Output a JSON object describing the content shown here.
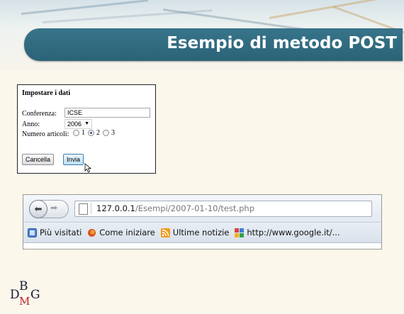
{
  "slide": {
    "title": "Esempio di metodo POST",
    "logo": "DBMG"
  },
  "form": {
    "heading": "Impostare i dati",
    "conference_label": "Conferenza:",
    "conference_value": "ICSE",
    "year_label": "Anno:",
    "year_value": "2006",
    "articles_label": "Numero articoli:",
    "articles_options": [
      "1",
      "2",
      "3"
    ],
    "articles_selected": "2",
    "cancel_label": "Cancella",
    "submit_label": "Invia"
  },
  "browser": {
    "url_host": "127.0.0.1",
    "url_path": "/Esempi/2007-01-10/test.php",
    "bookmarks": [
      {
        "label": "Più visitati",
        "icon": "most-visited-icon"
      },
      {
        "label": "Come iniziare",
        "icon": "firefox-icon"
      },
      {
        "label": "Ultime notizie",
        "icon": "rss-icon"
      },
      {
        "label": "http://www.google.it/...",
        "icon": "google-icon"
      }
    ]
  },
  "colors": {
    "title_bar": "#2f6b80",
    "slide_background": "#fbf7ea"
  }
}
